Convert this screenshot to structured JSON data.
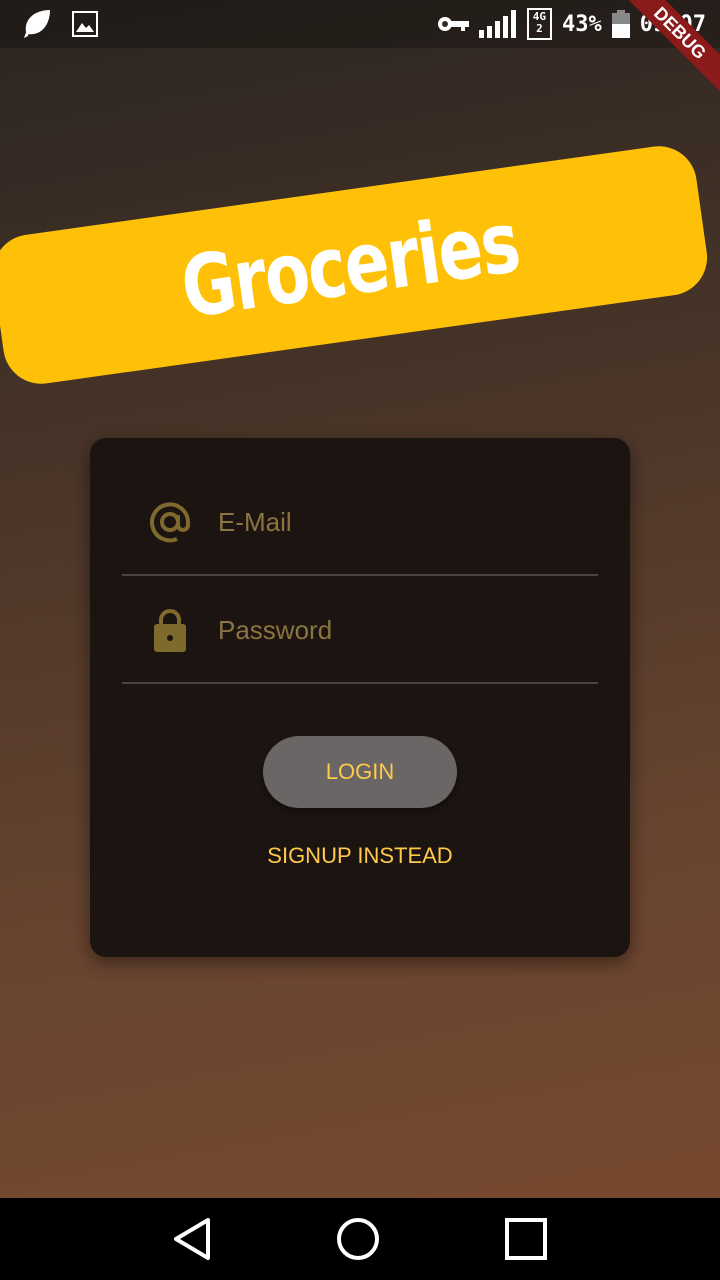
{
  "status_bar": {
    "battery": "43%",
    "time": "09:07",
    "network": "4G",
    "sim": "2",
    "debug_label": "DEBUG"
  },
  "banner": {
    "title": "Groceries"
  },
  "form": {
    "email_placeholder": "E-Mail",
    "password_placeholder": "Password",
    "login_label": "LOGIN",
    "signup_label": "SIGNUP INSTEAD"
  },
  "colors": {
    "accent": "#ffc107",
    "icon": "#7f6a2e",
    "text": "#ffc94a"
  }
}
